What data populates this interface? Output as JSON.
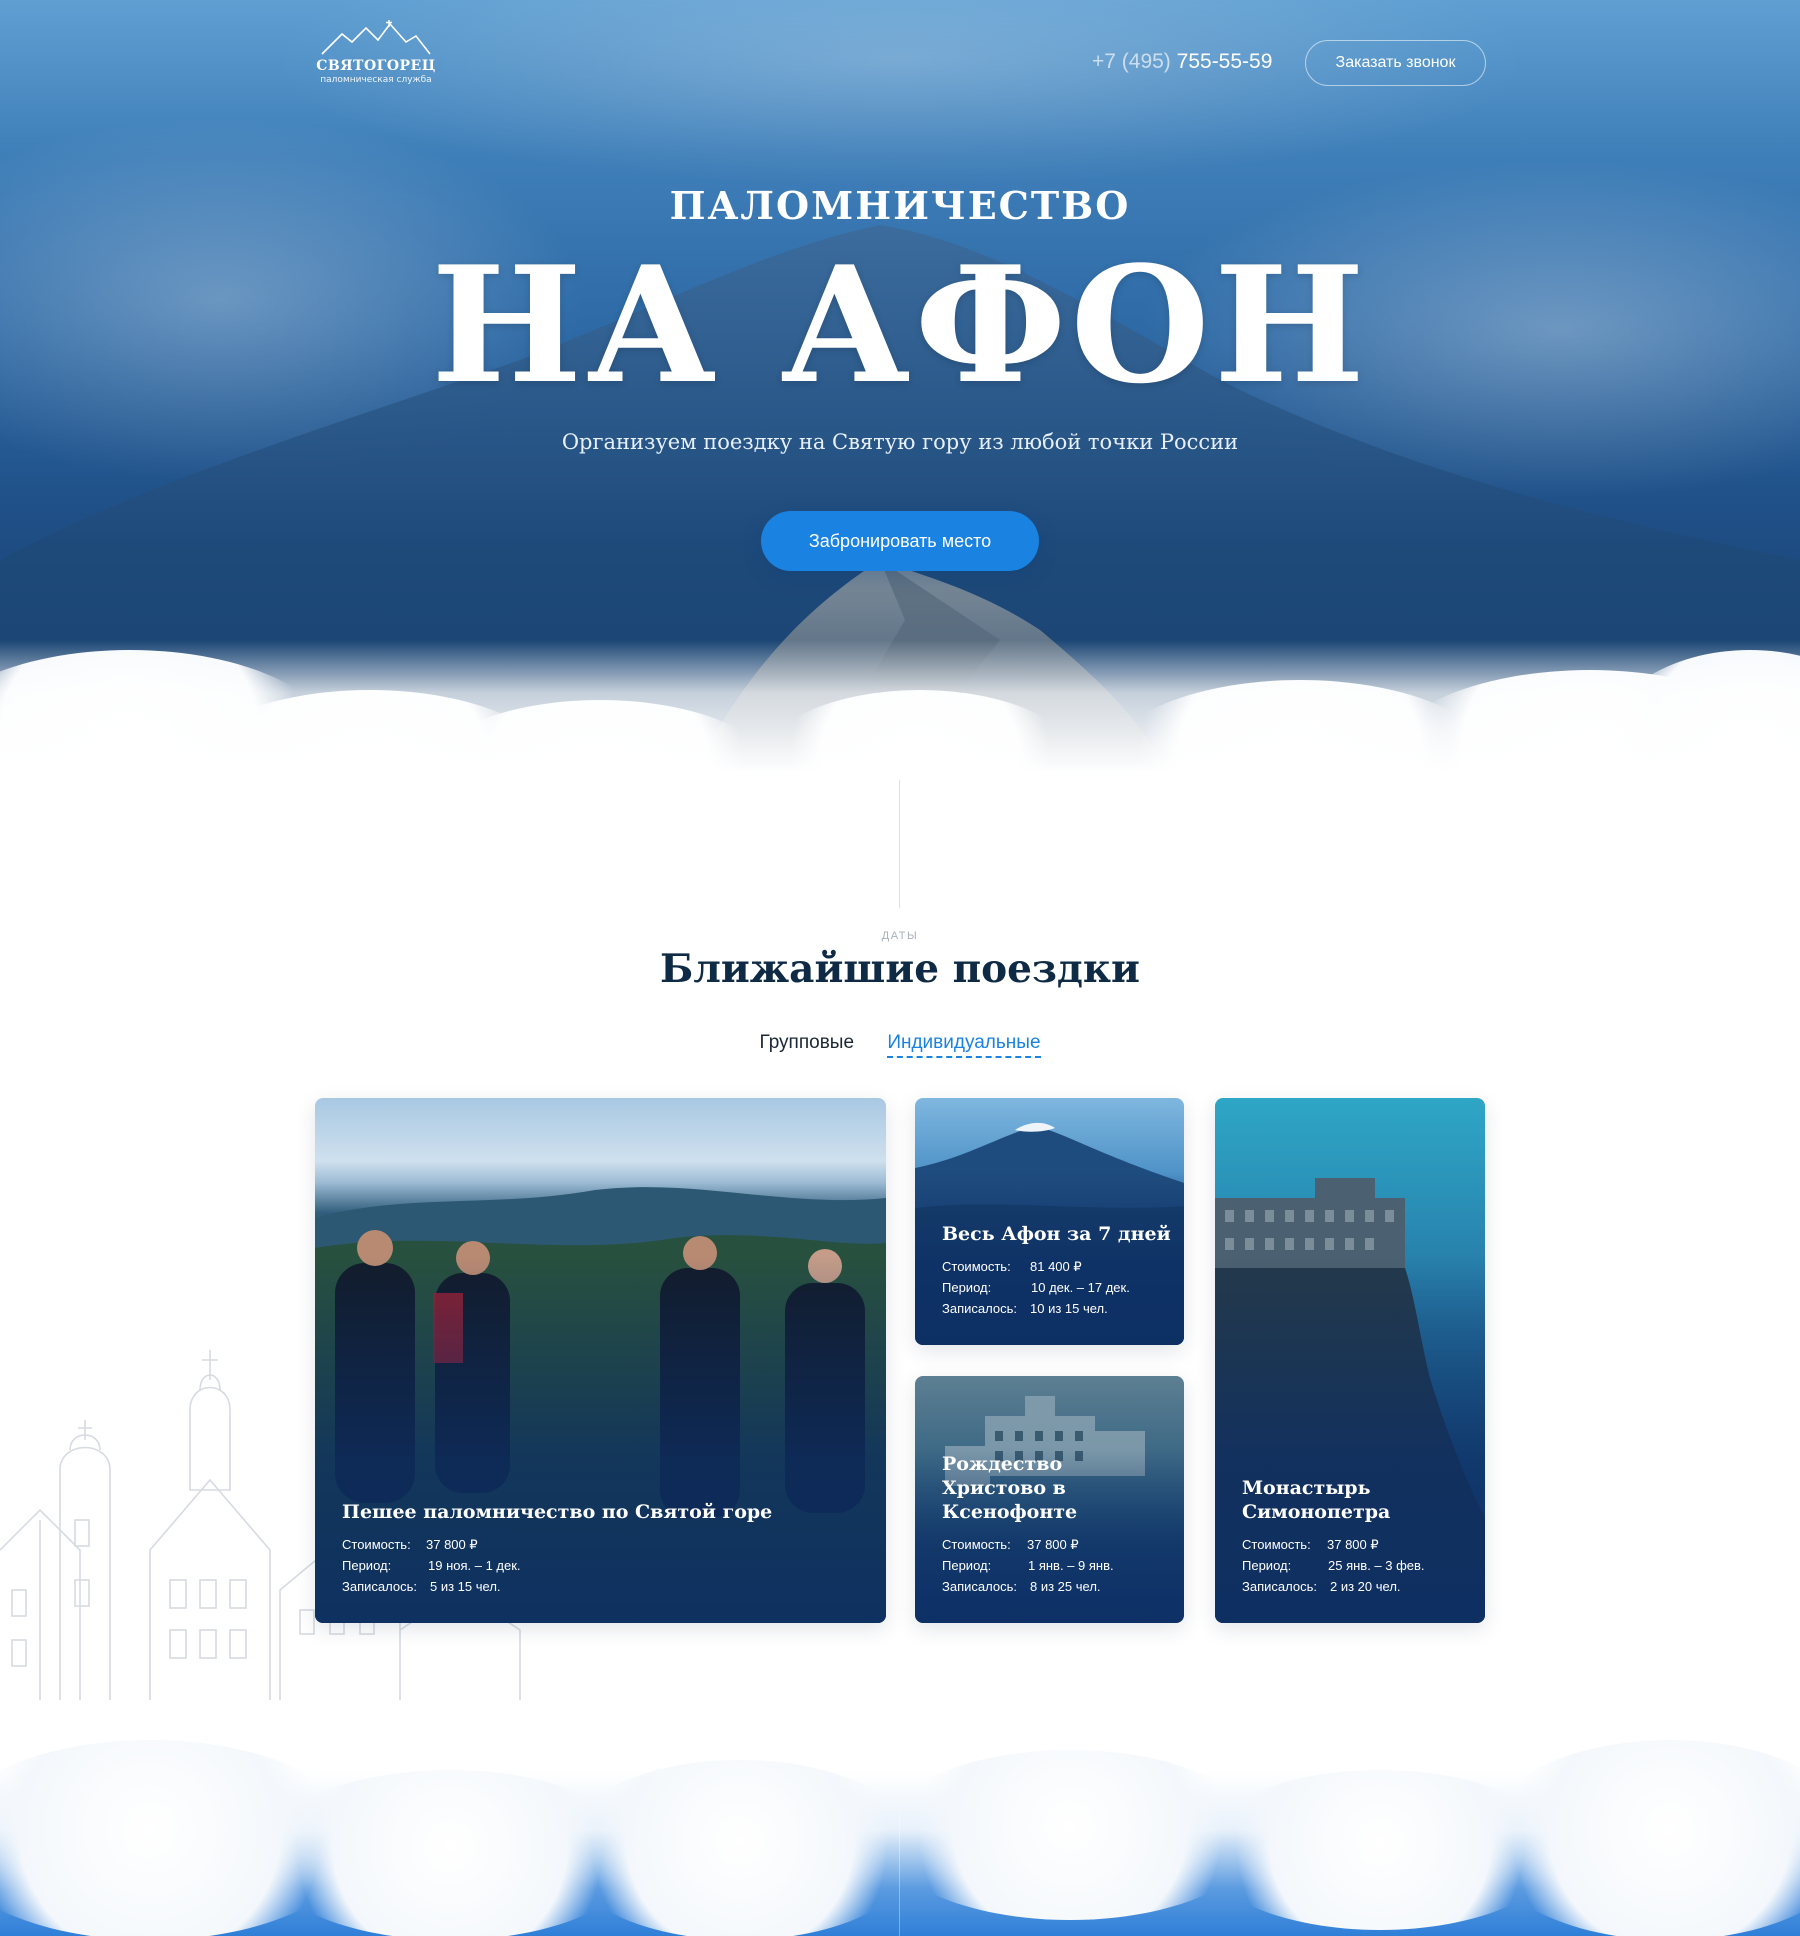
{
  "header": {
    "logo_name": "СВЯТОГОРЕЦ",
    "logo_sub": "паломническая служба",
    "phone_prefix": "+7 (495)",
    "phone_number": "755-55-59",
    "callback_label": "Заказать звонок"
  },
  "hero": {
    "subtitle": "ПАЛОМНИЧЕСТВО",
    "title": "НА АФОН",
    "description": "Организуем поездку на Святую гору из любой точки России",
    "cta_label": "Забронировать место"
  },
  "trips": {
    "kicker": "ДАТЫ",
    "title": "Ближайшие поездки",
    "tabs": [
      {
        "label": "Групповые",
        "active": true
      },
      {
        "label": "Индивидуальные",
        "active": false
      }
    ],
    "cards": [
      {
        "title": "Пешее паломничество по Святой горе",
        "price_label": "Стоимость:",
        "price": "37 800 ₽",
        "period_label": "Период:",
        "period": "19 ноя. – 1 дек.",
        "signed_label": "Записалось:",
        "signed": "5 из 15 чел."
      },
      {
        "title": "Весь Афон за 7 дней",
        "price_label": "Стоимость:",
        "price": "81 400 ₽",
        "period_label": "Период:",
        "period": "10 дек. – 17 дек.",
        "signed_label": "Записалось:",
        "signed": "10 из 15 чел."
      },
      {
        "title": "Рождество Христово в Ксенофонте",
        "price_label": "Стоимость:",
        "price": "37 800 ₽",
        "period_label": "Период:",
        "period": "1 янв. – 9 янв.",
        "signed_label": "Записалось:",
        "signed": "8 из 25 чел."
      },
      {
        "title": "Монастырь Симонопетра",
        "price_label": "Стоимость:",
        "price": "37 800 ₽",
        "period_label": "Период:",
        "period": "25 янв. – 3 фев.",
        "signed_label": "Записалось:",
        "signed": "2 из 20 чел."
      }
    ]
  },
  "colors": {
    "accent": "#1a82e0",
    "heading": "#0f2a44",
    "hero_sky": "#3f7fb9"
  }
}
